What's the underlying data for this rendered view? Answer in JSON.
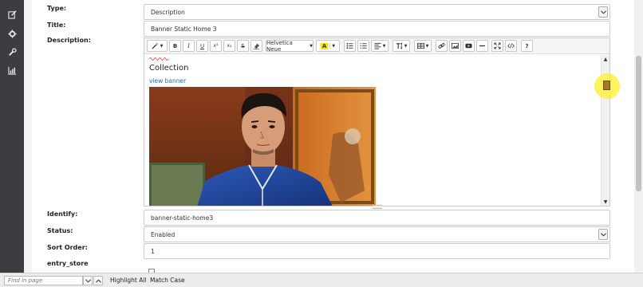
{
  "sidebar": {
    "items": [
      {
        "icon": "edit-icon"
      },
      {
        "icon": "gear-icon"
      },
      {
        "icon": "wrench-icon"
      },
      {
        "icon": "bar-chart-icon"
      }
    ]
  },
  "form": {
    "type_label": "Type:",
    "type_value": "Description",
    "title_label": "Title:",
    "title_value": "Banner Static Home 3",
    "description_label": "Description:",
    "identify_label": "Identify:",
    "identify_value": "banner-static-home3",
    "status_label": "Status:",
    "status_value": "Enabled",
    "sort_order_label": "Sort Order:",
    "sort_order_value": "1",
    "entry_store_label": "entry_store"
  },
  "editor": {
    "font_name": "Helvetica Neue",
    "buttons": {
      "bold": "B",
      "italic": "I",
      "underline": "U",
      "superscript": "x²",
      "subscript": "x₂",
      "strikethrough": "S",
      "font_color": "A",
      "help": "?"
    },
    "content": {
      "heading": "Collection",
      "link": "view banner"
    }
  },
  "findbar": {
    "placeholder": "Find in page",
    "highlight_all": "Highlight All",
    "match_case": "Match Case"
  },
  "colors": {
    "sidebar_bg": "#3b3d40",
    "link": "#2a6ead",
    "cursor_highlight": "#fff028"
  }
}
